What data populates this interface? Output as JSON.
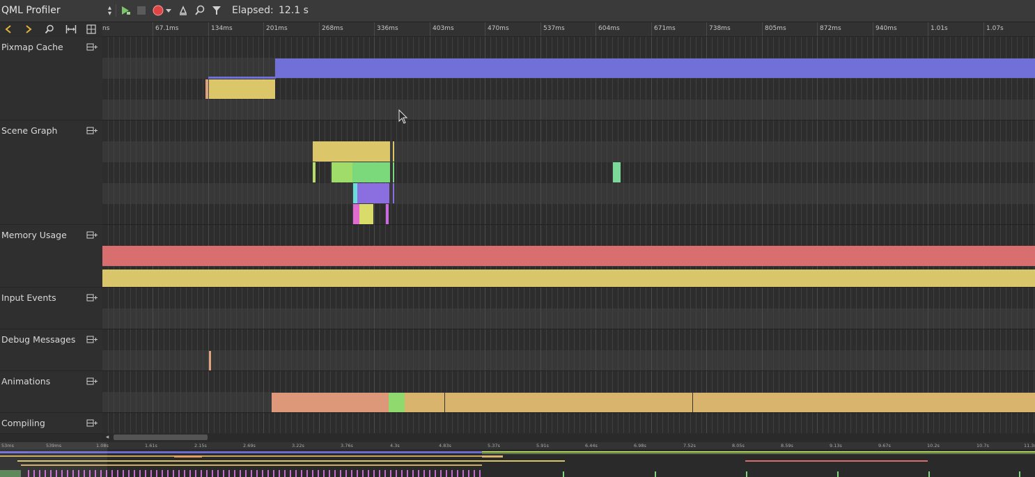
{
  "toolbar": {
    "view_selector": "QML Profiler",
    "elapsed_label": "Elapsed:",
    "elapsed_value": "12.1 s",
    "buttons": [
      "play-profiling-icon",
      "stop-icon",
      "record-icon",
      "record-options-icon",
      "clear-icon",
      "search-icon",
      "filter-icon"
    ]
  },
  "nav": {
    "buttons": [
      "chevron-left-icon",
      "chevron-right-icon",
      "zoom-icon",
      "range-select-icon",
      "range-lock-icon"
    ]
  },
  "ruler": {
    "ticks": [
      "ns",
      "67.1ms",
      "134ms",
      "201ms",
      "268ms",
      "336ms",
      "403ms",
      "470ms",
      "537ms",
      "604ms",
      "671ms",
      "738ms",
      "805ms",
      "872ms",
      "940ms",
      "1.01s",
      "1.07s"
    ]
  },
  "categories": [
    {
      "name": "Pixmap Cache"
    },
    {
      "name": "Scene Graph"
    },
    {
      "name": "Memory Usage"
    },
    {
      "name": "Input Events"
    },
    {
      "name": "Debug Messages"
    },
    {
      "name": "Animations"
    },
    {
      "name": "Compiling"
    }
  ],
  "overview": {
    "ticks": [
      "53ms",
      "539ms",
      "1.08s",
      "1.61s",
      "2.15s",
      "2.69s",
      "3.22s",
      "3.76s",
      "4.3s",
      "4.83s",
      "5.37s",
      "5.91s",
      "6.44s",
      "6.98s",
      "7.52s",
      "8.05s",
      "8.59s",
      "9.13s",
      "9.67s",
      "10.2s",
      "10.7s",
      "11.3s"
    ]
  },
  "colors": {
    "pixmap_blue": "#7070d8",
    "pixmap_yellow": "#dcc66a",
    "memory_red": "#d96e6e",
    "memory_yellow": "#d9c56a",
    "anim_salmon": "#dc9878",
    "anim_tan": "#d9b46c",
    "sg_green": "#7bd97b",
    "sg_violet": "#8b6ee0"
  }
}
